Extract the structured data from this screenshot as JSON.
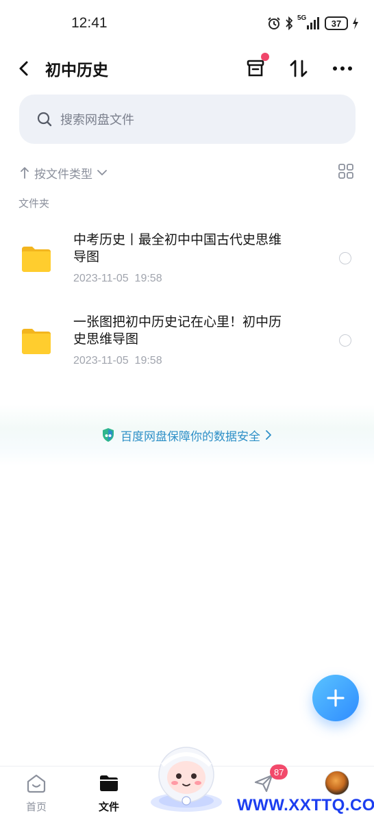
{
  "status_bar": {
    "time": "12:41",
    "network": "5G",
    "battery": "37"
  },
  "header": {
    "title": "初中历史",
    "icons": [
      "back-arrow-icon",
      "trash-box-icon",
      "sort-arrows-icon",
      "more-icon"
    ],
    "notification_dot_color": "#f0466a"
  },
  "search": {
    "placeholder": "搜索网盘文件"
  },
  "sort": {
    "label": "按文件类型"
  },
  "section": {
    "label": "文件夹"
  },
  "files": [
    {
      "name_line1": "中考历史丨最全初中中国古代史思维",
      "name_line2": "导图",
      "date": "2023-11-05",
      "time": "19:58"
    },
    {
      "name_line1": "一张图把初中历史记在心里！初中历",
      "name_line2": "史思维导图",
      "date": "2023-11-05",
      "time": "19:58"
    }
  ],
  "security_banner": {
    "text": "百度网盘保障你的数据安全"
  },
  "bottom_nav": {
    "home_label": "首页",
    "files_label": "文件",
    "share_badge": "87"
  },
  "watermark": "WWW.XXTTQ.COM",
  "colors": {
    "accent": "#2f8cff",
    "folder": "#ffc928",
    "badge": "#f24a6b",
    "security_text": "#2d8fc7"
  }
}
